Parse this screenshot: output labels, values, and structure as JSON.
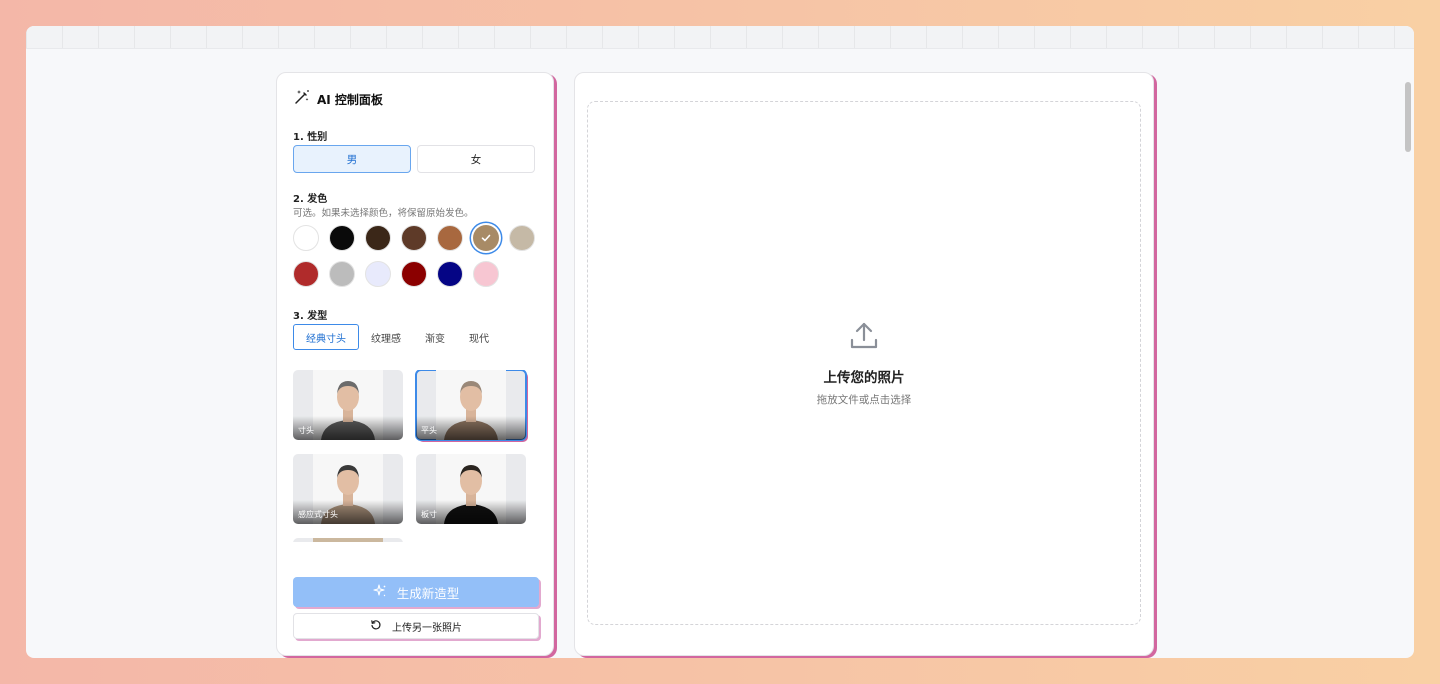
{
  "panel": {
    "title": "AI 控制面板",
    "icon": "magic-wand-icon"
  },
  "gender": {
    "label": "1. 性别",
    "options": [
      "男",
      "女"
    ],
    "selected": "男"
  },
  "hair_color": {
    "label": "2. 发色",
    "hint": "可选。如果未选择颜色，将保留原始发色。",
    "swatches": [
      "#ffffff",
      "#0a0a0a",
      "#3b2718",
      "#5e3a28",
      "#a8683f",
      "#a88b66",
      "#c5b9a6",
      "#b02b2b",
      "#bcbcbc",
      "#e8eafc",
      "#8b0000",
      "#050585",
      "#f7c6d2"
    ],
    "selected_index": 5
  },
  "hair_style": {
    "label": "3. 发型",
    "tabs": [
      "经典寸头",
      "纹理感",
      "渐变",
      "现代"
    ],
    "active_tab": "经典寸头",
    "cards": [
      {
        "caption": "寸头",
        "selected": false,
        "shirt": "#5a5a5a",
        "hair": "#6b6b6b"
      },
      {
        "caption": "平头",
        "selected": true,
        "shirt": "#8b7360",
        "hair": "#9a8878"
      },
      {
        "caption": "感应式寸头",
        "selected": false,
        "shirt": "#a8907a",
        "hair": "#3a3a3a"
      },
      {
        "caption": "板寸",
        "selected": false,
        "shirt": "#111111",
        "hair": "#2a2520"
      }
    ]
  },
  "actions": {
    "generate_label": "生成新造型",
    "reupload_label": "上传另一张照片"
  },
  "upload": {
    "title": "上传您的照片",
    "subtitle": "拖放文件或点击选择"
  }
}
